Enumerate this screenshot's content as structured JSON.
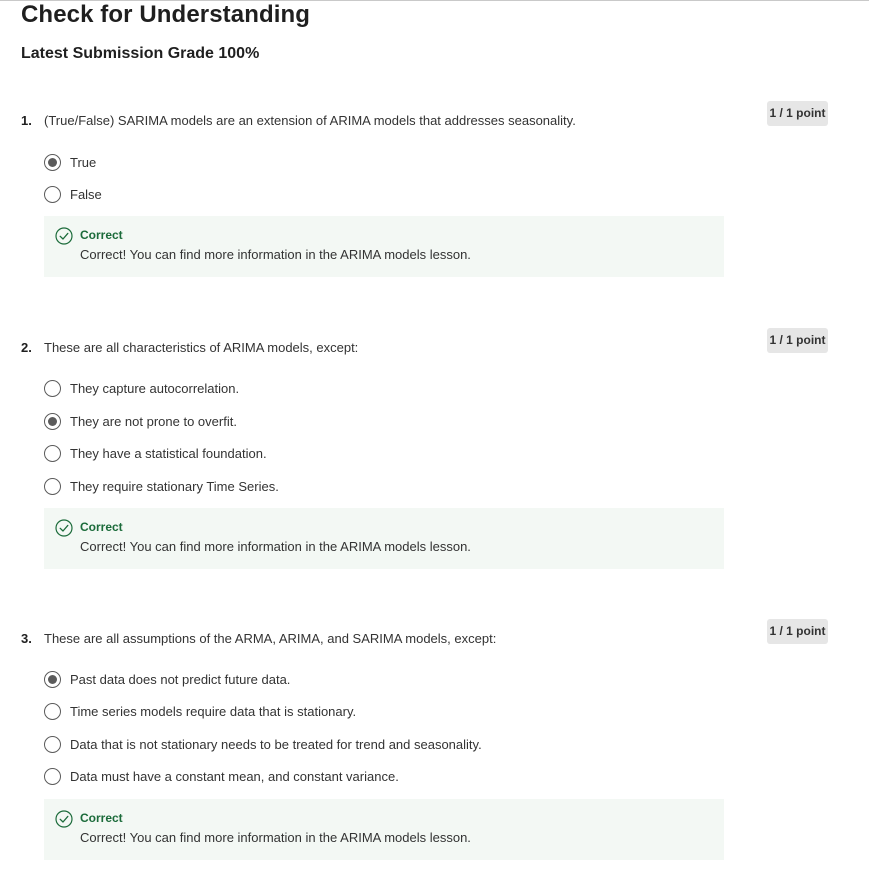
{
  "page": {
    "title": "Check for Understanding",
    "grade_text": "Latest Submission Grade 100%"
  },
  "questions": [
    {
      "number": "1.",
      "text": "(True/False) SARIMA models are an extension of ARIMA models that addresses seasonality.",
      "points": "1 / 1 point",
      "options": [
        {
          "label": "True",
          "selected": true
        },
        {
          "label": "False",
          "selected": false
        }
      ],
      "feedback": {
        "icon": "check-circle-icon",
        "status": "Correct",
        "message": "Correct! You can find more information in the ARIMA models lesson."
      }
    },
    {
      "number": "2.",
      "text": "These are all characteristics of ARIMA models, except:",
      "points": "1 / 1 point",
      "options": [
        {
          "label": "They capture autocorrelation.",
          "selected": false
        },
        {
          "label": "They are not prone to overfit.",
          "selected": true
        },
        {
          "label": "They have a statistical foundation.",
          "selected": false
        },
        {
          "label": "They require stationary Time Series.",
          "selected": false
        }
      ],
      "feedback": {
        "icon": "check-circle-icon",
        "status": "Correct",
        "message": "Correct! You can find more information in the ARIMA models lesson."
      }
    },
    {
      "number": "3.",
      "text": "These are all assumptions of the ARMA, ARIMA, and SARIMA models, except:",
      "points": "1 / 1 point",
      "options": [
        {
          "label": "Past data does not predict future data.",
          "selected": true
        },
        {
          "label": "Time series models require data that is stationary.",
          "selected": false
        },
        {
          "label": "Data that is not stationary needs to be treated for trend and seasonality.",
          "selected": false
        },
        {
          "label": "Data must have a constant mean, and constant variance.",
          "selected": false
        }
      ],
      "feedback": {
        "icon": "check-circle-icon",
        "status": "Correct",
        "message": "Correct! You can find more information in the ARIMA models lesson."
      }
    }
  ],
  "colors": {
    "correct_text": "#1b6b3a",
    "feedback_bg": "#f3f8f4",
    "badge_bg": "#e6e6e6",
    "radio": "#5b5b5b"
  }
}
